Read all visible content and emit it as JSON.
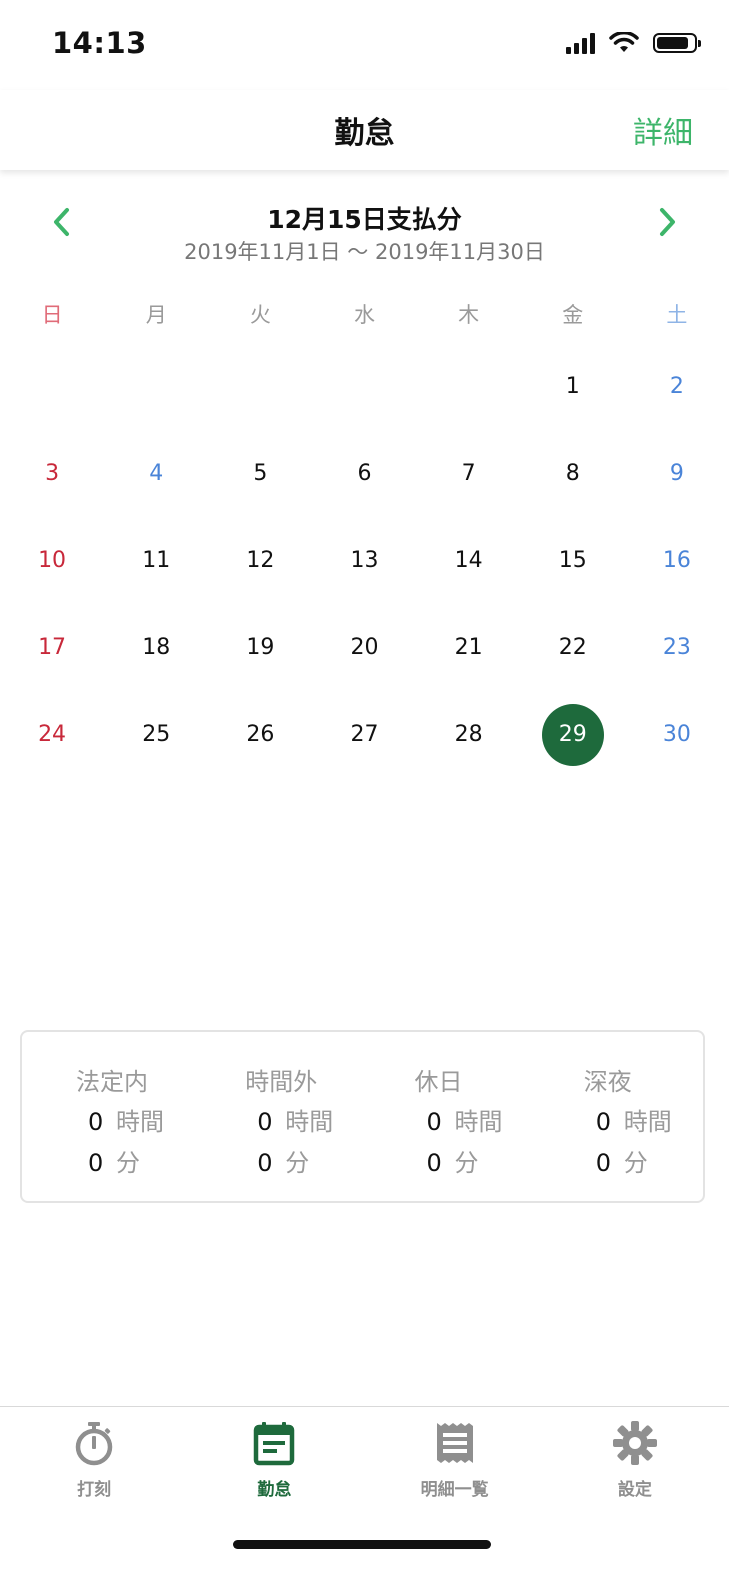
{
  "status_bar": {
    "time": "14:13",
    "battery_level": 0.85
  },
  "nav": {
    "title": "勤怠",
    "detail_label": "詳細"
  },
  "period": {
    "title": "12月15日支払分",
    "range": "2019年11月1日 〜 2019年11月30日"
  },
  "calendar": {
    "weekdays": [
      "日",
      "月",
      "火",
      "水",
      "木",
      "金",
      "土"
    ],
    "weeks": [
      [
        "",
        "",
        "",
        "",
        "",
        "1",
        "2"
      ],
      [
        "3",
        "4",
        "5",
        "6",
        "7",
        "8",
        "9"
      ],
      [
        "10",
        "11",
        "12",
        "13",
        "14",
        "15",
        "16"
      ],
      [
        "17",
        "18",
        "19",
        "20",
        "21",
        "22",
        "23"
      ],
      [
        "24",
        "25",
        "26",
        "27",
        "28",
        "29",
        "30"
      ]
    ],
    "holidays": [
      "4"
    ],
    "selected_day": "29",
    "colors": {
      "sunday": "#c8283a",
      "saturday": "#4a84d8",
      "selected": "#1e6a3c"
    }
  },
  "summary": [
    {
      "label": "法定内",
      "hours": "0",
      "hours_unit": "時間",
      "minutes": "0",
      "minutes_unit": "分"
    },
    {
      "label": "時間外",
      "hours": "0",
      "hours_unit": "時間",
      "minutes": "0",
      "minutes_unit": "分"
    },
    {
      "label": "休日",
      "hours": "0",
      "hours_unit": "時間",
      "minutes": "0",
      "minutes_unit": "分"
    },
    {
      "label": "深夜",
      "hours": "0",
      "hours_unit": "時間",
      "minutes": "0",
      "minutes_unit": "分"
    }
  ],
  "tabs": [
    {
      "label": "打刻",
      "icon": "stopwatch-icon",
      "active": false
    },
    {
      "label": "勤怠",
      "icon": "calendar-icon",
      "active": true
    },
    {
      "label": "明細一覧",
      "icon": "receipt-icon",
      "active": false
    },
    {
      "label": "設定",
      "icon": "gear-icon",
      "active": false
    }
  ],
  "accent_color": "#3db56a"
}
